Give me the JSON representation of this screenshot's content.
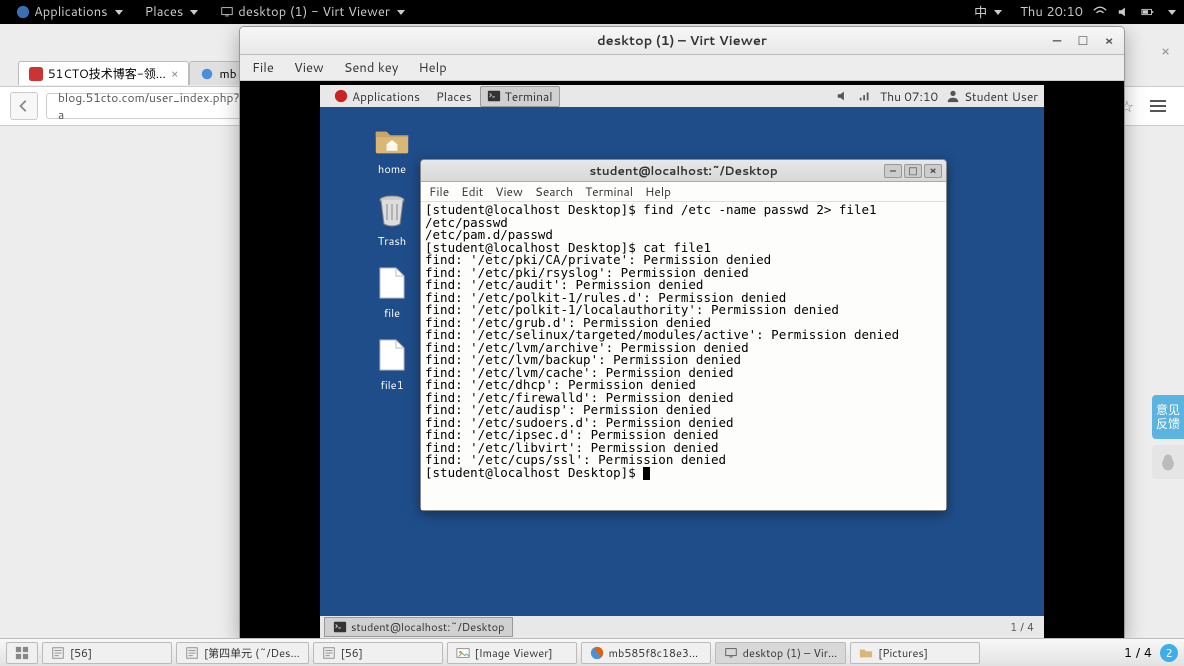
{
  "host_panel": {
    "applications": "Applications",
    "places": "Places",
    "active_app": "desktop (1) - Virt Viewer",
    "lang": "中",
    "clock": "Thu 20:10"
  },
  "host_tabs": {
    "tab1": "51CTO技术博客-领...",
    "tab2": "mb"
  },
  "host_url": "blog.51cto.com/user_index.php?a",
  "virt": {
    "title": "desktop (1) – Virt Viewer",
    "menu": {
      "file": "File",
      "view": "View",
      "sendkey": "Send key",
      "help": "Help"
    }
  },
  "guest_panel": {
    "applications": "Applications",
    "places": "Places",
    "task": "Terminal",
    "clock": "Thu 07:10",
    "user": "Student User"
  },
  "desktop_icons": {
    "home": "home",
    "trash": "Trash",
    "file": "file",
    "file1": "file1"
  },
  "terminal": {
    "title": "student@localhost:~/Desktop",
    "menu": {
      "file": "File",
      "edit": "Edit",
      "view": "View",
      "search": "Search",
      "terminal": "Terminal",
      "help": "Help"
    },
    "lines": [
      "[student@localhost Desktop]$ find /etc -name passwd 2> file1",
      "/etc/passwd",
      "/etc/pam.d/passwd",
      "[student@localhost Desktop]$ cat file1",
      "find: '/etc/pki/CA/private': Permission denied",
      "find: '/etc/pki/rsyslog': Permission denied",
      "find: '/etc/audit': Permission denied",
      "find: '/etc/polkit-1/rules.d': Permission denied",
      "find: '/etc/polkit-1/localauthority': Permission denied",
      "find: '/etc/grub.d': Permission denied",
      "find: '/etc/selinux/targeted/modules/active': Permission denied",
      "find: '/etc/lvm/archive': Permission denied",
      "find: '/etc/lvm/backup': Permission denied",
      "find: '/etc/lvm/cache': Permission denied",
      "find: '/etc/dhcp': Permission denied",
      "find: '/etc/firewalld': Permission denied",
      "find: '/etc/audisp': Permission denied",
      "find: '/etc/sudoers.d': Permission denied",
      "find: '/etc/ipsec.d': Permission denied",
      "find: '/etc/libvirt': Permission denied",
      "find: '/etc/cups/ssl': Permission denied",
      "[student@localhost Desktop]$ "
    ]
  },
  "guest_taskbar": {
    "task": "student@localhost:~/Desktop",
    "workspace": "1 / 4"
  },
  "host_taskbar": {
    "items": [
      "[56]",
      "[第四单元 (~/Des...",
      "[56]",
      "[Image Viewer]",
      "mb585f8c18e3...",
      "desktop (1) – Vir...",
      "[Pictures]"
    ],
    "pager": "1 / 4",
    "badge": "2"
  },
  "feedback": "意见\n反馈"
}
